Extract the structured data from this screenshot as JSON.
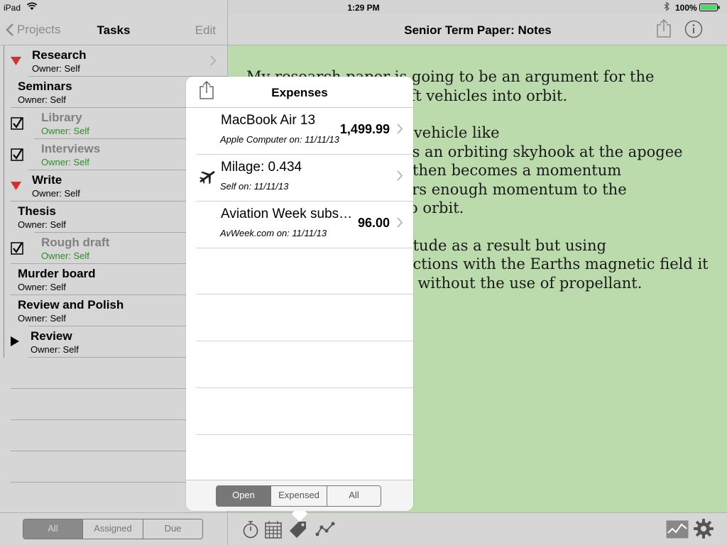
{
  "status_bar": {
    "carrier": "iPad",
    "time": "1:29 PM",
    "battery": "100%",
    "battery_level": 1.0
  },
  "left_nav": {
    "back_label": "Projects",
    "title": "Tasks",
    "edit_label": "Edit"
  },
  "tasks": [
    {
      "name": "Research",
      "owner": "Owner: Self",
      "state": "expanded",
      "has_disclosure": true
    },
    {
      "name": "Seminars",
      "owner": "Owner: Self",
      "state": "none"
    },
    {
      "name": "Library",
      "owner": "Owner: Self",
      "state": "done"
    },
    {
      "name": "Interviews",
      "owner": "Owner: Self",
      "state": "done"
    },
    {
      "name": "Write",
      "owner": "Owner: Self",
      "state": "expanded"
    },
    {
      "name": "Thesis",
      "owner": "Owner: Self",
      "state": "none"
    },
    {
      "name": "Rough draft",
      "owner": "Owner: Self",
      "state": "done"
    },
    {
      "name": "Murder board",
      "owner": "Owner: Self",
      "state": "none"
    },
    {
      "name": "Review and Polish",
      "owner": "Owner: Self",
      "state": "none"
    },
    {
      "name": "Review",
      "owner": "Owner: Self",
      "state": "collapsed"
    }
  ],
  "left_filter": {
    "options": [
      "All",
      "Assigned",
      "Due"
    ],
    "selected": "All"
  },
  "right_nav": {
    "title": "Senior Term Paper: Notes"
  },
  "notes": {
    "lines": [
      "My research paper is going to be an argument for the",
      "use of a skyhook to loft vehicles into orbit.",
      "",
      "A manned sub-orbital vehicle like",
      "SpaceShipTwo catches an orbiting skyhook at the apogee",
      "of its flight. The hook then becomes a momentum",
      "exchange that transfers enough momentum to the",
      "vehicle and lobs it into orbit.",
      "",
      "The skyhook loses altitude as a result but using",
      "electrodynamic interactions with the Earths magnetic field it",
      "can regain its altitude without the use of propellant."
    ]
  },
  "popover": {
    "title": "Expenses",
    "items": [
      {
        "name": "MacBook Air 13",
        "sub": "Apple Computer on: 11/11/13",
        "amount": "1,499.99",
        "icon": ""
      },
      {
        "name": "Milage: 0.434",
        "sub": "Self on: 11/11/13",
        "amount": "",
        "icon": "airplane-icon"
      },
      {
        "name": "Aviation Week subscription",
        "sub": "AvWeek.com on: 11/11/13",
        "amount": "96.00",
        "icon": ""
      }
    ],
    "filter": {
      "options": [
        "Open",
        "Expensed",
        "All"
      ],
      "selected": "Open"
    }
  },
  "colors": {
    "notes_background": "#bcdbad",
    "pane_background": "#d6d6d6",
    "expanded_triangle": "#cc3333",
    "done_owner": "#2e8b2e"
  }
}
